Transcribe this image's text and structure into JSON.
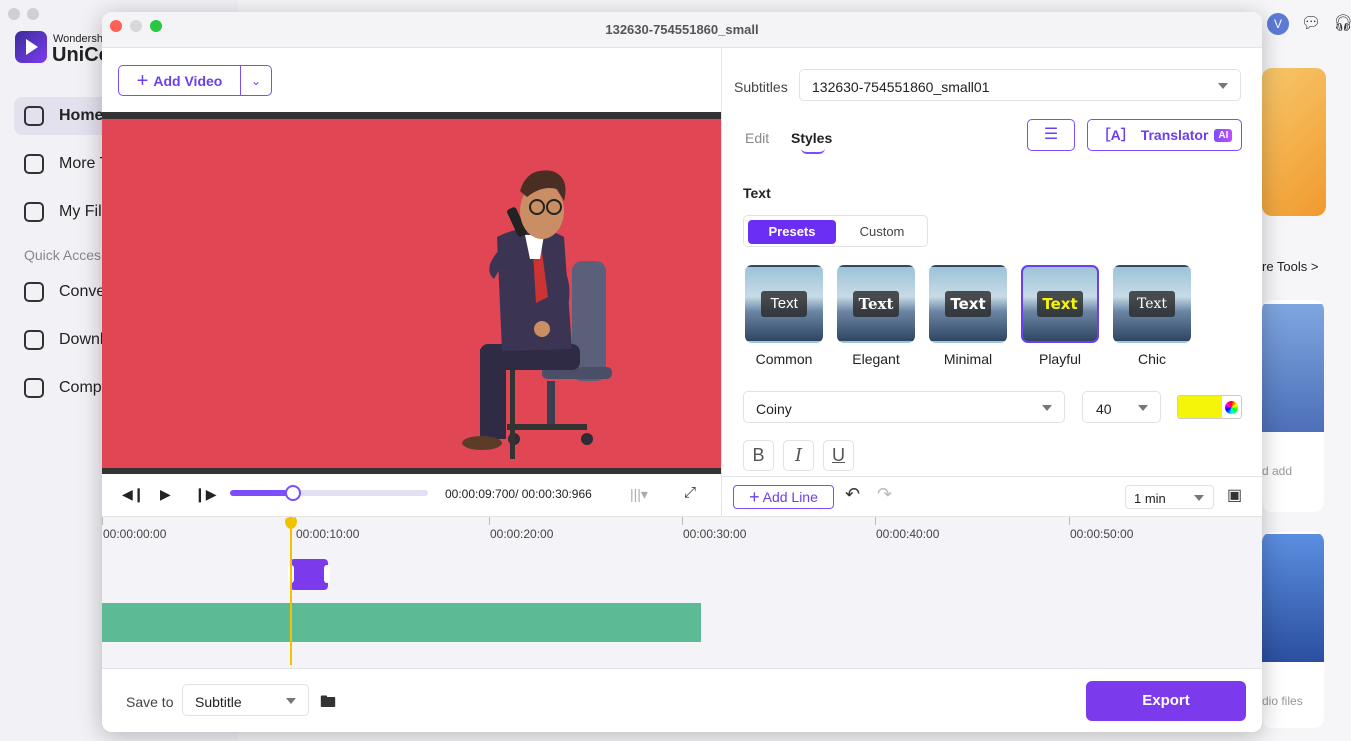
{
  "background_app": {
    "brand_small": "Wondersh",
    "brand": "UniCo",
    "nav": [
      {
        "label": "Home"
      },
      {
        "label": "More T"
      },
      {
        "label": "My Fil"
      }
    ],
    "quick_access_label": "Quick Acces",
    "quick_items": [
      {
        "label": "Conve"
      },
      {
        "label": "Downl"
      },
      {
        "label": "Comp"
      }
    ],
    "avatar_letter": "V",
    "more_tools_label": "re Tools >",
    "card2_text": "d add",
    "card3_text": "dio files"
  },
  "dialog": {
    "title": "132630-754551860_small",
    "add_video_label": "Add Video",
    "player": {
      "timecode": "00:00:09:700/ 00:00:30:966",
      "progress_fraction": 0.32
    },
    "subtitles_label": "Subtitles",
    "subtitles_value": "132630-754551860_small01",
    "tabs": {
      "edit": "Edit",
      "styles": "Styles"
    },
    "translator_label": "Translator",
    "ai_badge": "AI",
    "text_heading": "Text",
    "segment": {
      "presets": "Presets",
      "custom": "Custom"
    },
    "preset_thumb_text": "Text",
    "presets": [
      {
        "label": "Common",
        "selected": false
      },
      {
        "label": "Elegant",
        "selected": false
      },
      {
        "label": "Minimal",
        "selected": false
      },
      {
        "label": "Playful",
        "selected": true
      },
      {
        "label": "Chic",
        "selected": false
      }
    ],
    "font_value": "Coiny",
    "size_value": "40",
    "text_color": "#f5f50a",
    "format_buttons": {
      "bold": "B",
      "italic": "I",
      "underline": "U"
    },
    "add_line_label": "Add Line",
    "zoom_value": "1 min",
    "timeline_ticks": [
      "00:00:00:00",
      "00:00:10:00",
      "00:00:20:00",
      "00:00:30:00",
      "00:00:40:00",
      "00:00:50:00"
    ],
    "save_to_label": "Save to",
    "save_to_value": "Subtitle",
    "export_label": "Export"
  },
  "colors": {
    "accent": "#7c3aed",
    "video_bg": "#e14654",
    "clip_green": "#5cbb95",
    "playhead": "#f2c200"
  }
}
